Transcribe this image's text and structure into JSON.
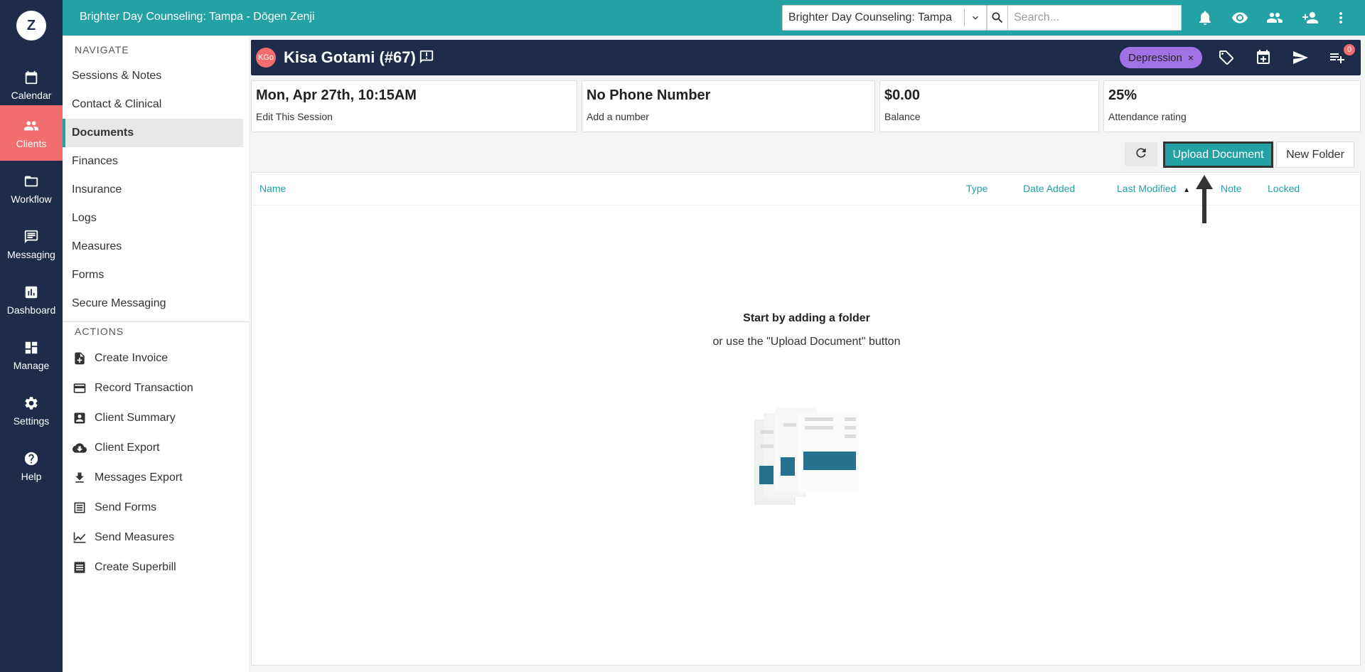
{
  "app": {
    "logo_letter": "Z",
    "title": "Brighter Day Counseling: Tampa - Dōgen Zenji"
  },
  "rail": [
    {
      "label": "Calendar",
      "icon": "calendar-icon"
    },
    {
      "label": "Clients",
      "icon": "clients-icon",
      "active": true
    },
    {
      "label": "Workflow",
      "icon": "folder-icon"
    },
    {
      "label": "Messaging",
      "icon": "message-icon"
    },
    {
      "label": "Dashboard",
      "icon": "chart-icon"
    },
    {
      "label": "Manage",
      "icon": "dashboard-icon"
    },
    {
      "label": "Settings",
      "icon": "gear-icon"
    },
    {
      "label": "Help",
      "icon": "help-icon"
    }
  ],
  "topbar": {
    "practice": "Brighter Day Counseling: Tampa",
    "search_placeholder": "Search...",
    "icons": [
      "bell-icon",
      "eye-icon",
      "people-icon",
      "add-person-icon",
      "more-vert-icon"
    ]
  },
  "sidebar": {
    "navigate_label": "NAVIGATE",
    "nav_items": [
      "Sessions & Notes",
      "Contact & Clinical",
      "Documents",
      "Finances",
      "Insurance",
      "Logs",
      "Measures",
      "Forms",
      "Secure Messaging"
    ],
    "active_nav": "Documents",
    "actions_label": "ACTIONS",
    "action_items": [
      {
        "label": "Create Invoice",
        "icon": "invoice-icon"
      },
      {
        "label": "Record Transaction",
        "icon": "credit-card-icon"
      },
      {
        "label": "Client Summary",
        "icon": "account-box-icon"
      },
      {
        "label": "Client Export",
        "icon": "cloud-download-icon"
      },
      {
        "label": "Messages Export",
        "icon": "download-icon"
      },
      {
        "label": "Send Forms",
        "icon": "list-doc-icon"
      },
      {
        "label": "Send Measures",
        "icon": "line-chart-icon"
      },
      {
        "label": "Create Superbill",
        "icon": "receipt-icon"
      }
    ]
  },
  "client": {
    "initials": "KGo",
    "name": "Kisa Gotami (#67)",
    "tag": "Depression",
    "tag_remove": "×",
    "header_icons": [
      "tags-icon",
      "calendar-add-icon",
      "send-icon",
      "playlist-add-icon"
    ],
    "badge_count": "0"
  },
  "cards": [
    {
      "big": "Mon, Apr 27th, 10:15AM",
      "small": "Edit This Session"
    },
    {
      "big": "No Phone Number",
      "small": "Add a number"
    },
    {
      "big": "$0.00",
      "small": "Balance"
    },
    {
      "big": "25%",
      "small": "Attendance rating"
    }
  ],
  "toolbar": {
    "upload_label": "Upload Document",
    "new_folder_label": "New Folder"
  },
  "table": {
    "headers": [
      "Name",
      "Type",
      "Date Added",
      "Last Modified",
      "Note",
      "Locked"
    ],
    "sort_column": "Last Modified",
    "sort_indicator": "▲"
  },
  "empty_state": {
    "title": "Start by adding a folder",
    "subtitle": "or use the \"Upload Document\" button"
  },
  "colors": {
    "teal": "#23a1a5",
    "navy": "#1e2b4a",
    "coral": "#f26d6d",
    "tag_purple": "#a172e6"
  }
}
